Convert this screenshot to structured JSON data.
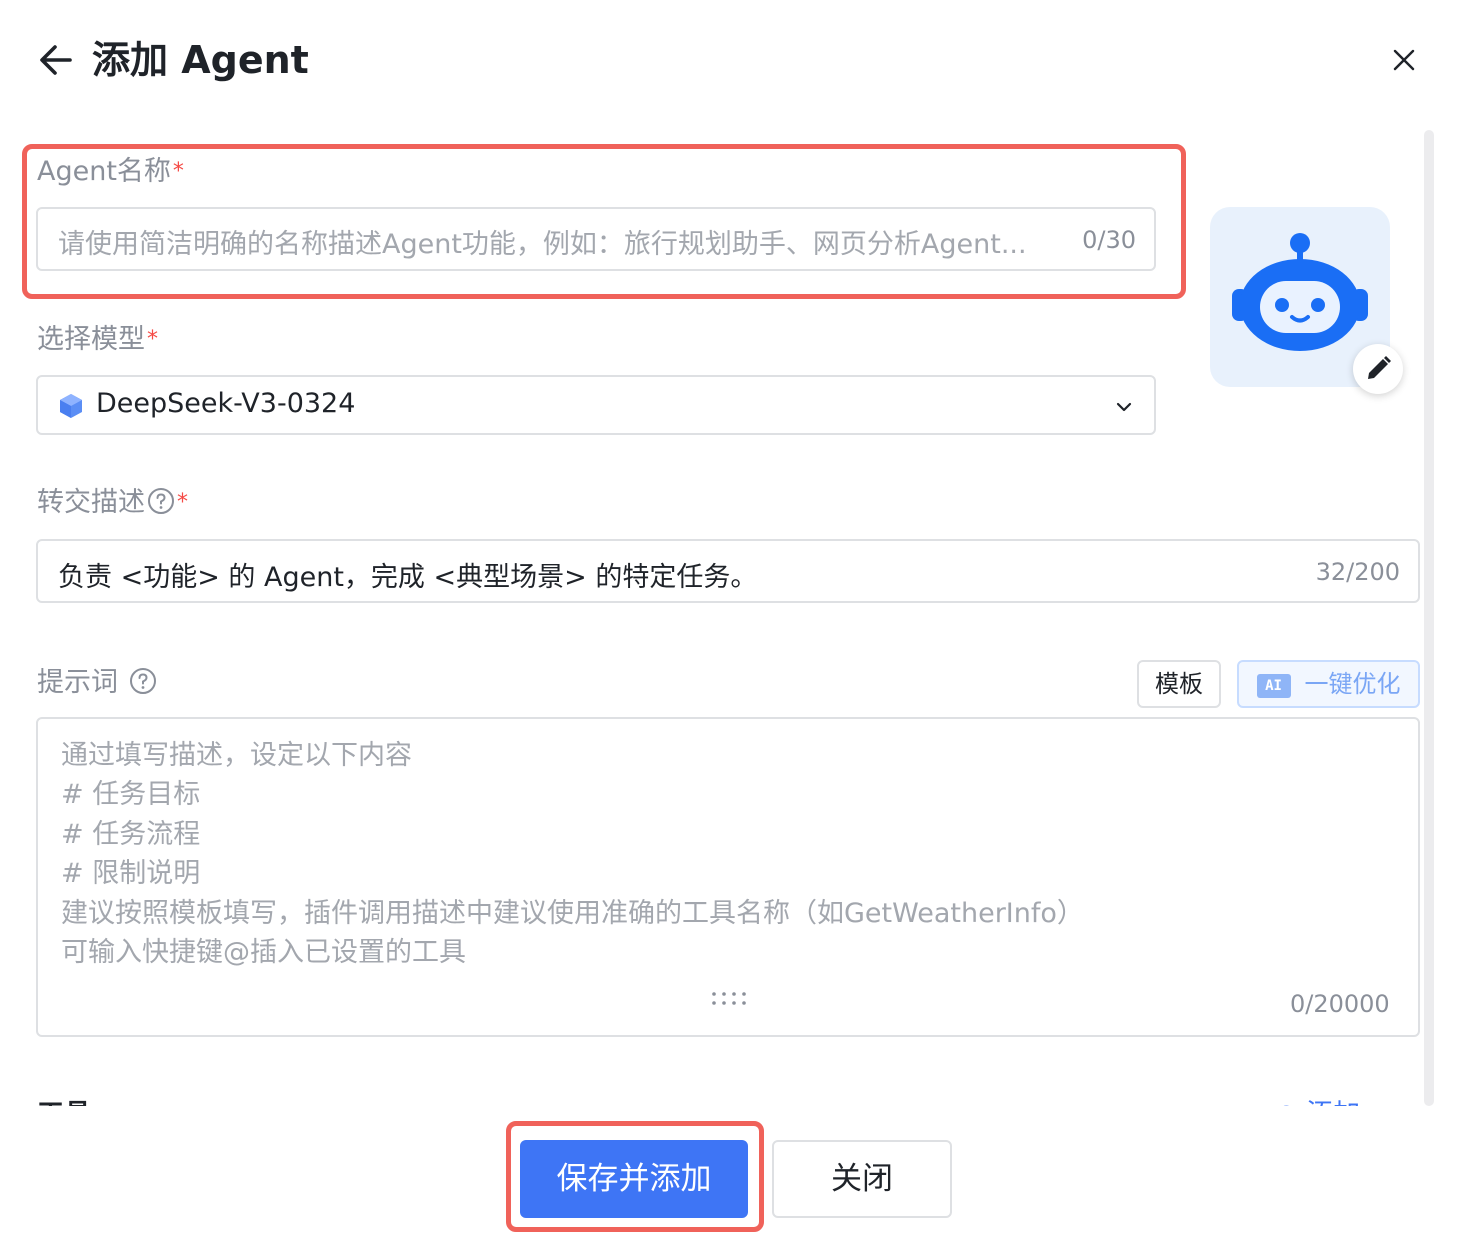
{
  "header": {
    "title": "添加 Agent"
  },
  "agent_name": {
    "label": "Agent名称",
    "required_mark": "*",
    "placeholder": "请使用简洁明确的名称描述Agent功能，例如：旅行规划助手、网页分析Agent...",
    "counter": "0/30"
  },
  "model": {
    "label": "选择模型",
    "required_mark": "*",
    "selected_value": "DeepSeek-V3-0324"
  },
  "handoff": {
    "label": "转交描述",
    "required_mark": "*",
    "value": "负责 <功能> 的 Agent，完成 <典型场景> 的特定任务。",
    "counter": "32/200"
  },
  "prompt": {
    "label": "提示词",
    "template_button": "模板",
    "ai_badge": "AI",
    "optimize_button": "一键优化",
    "placeholder_lines": [
      "通过填写描述，设定以下内容",
      "# 任务目标",
      "# 任务流程",
      "# 限制说明",
      "建议按照模板填写，插件调用描述中建议使用准确的工具名称（如GetWeatherInfo）",
      "可输入快捷键@插入已设置的工具"
    ],
    "counter": "0/20000"
  },
  "tools": {
    "label": "工具",
    "add_label": "添加"
  },
  "footer": {
    "save_button": "保存并添加",
    "close_button": "关闭"
  },
  "colors": {
    "primary": "#3e75f5",
    "highlight": "#f0625a",
    "required": "#f54a45",
    "robot": "#1a6ef5",
    "avatar_bg": "#e8f1fc"
  }
}
